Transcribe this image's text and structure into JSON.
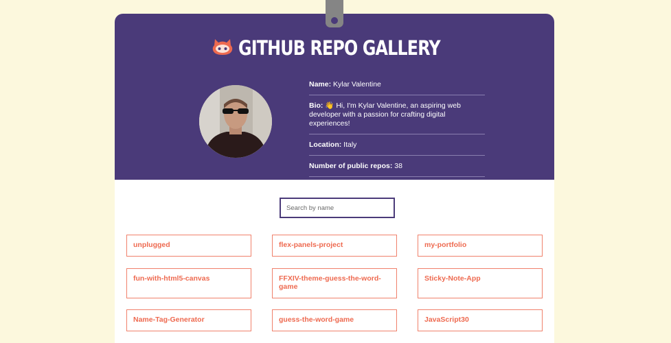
{
  "header": {
    "title": "GITHUB REPO GALLERY",
    "logo_icon": "octocat-icon",
    "background_color": "#4a3a79"
  },
  "profile": {
    "avatar_icon": "user-avatar",
    "name_label": "Name:",
    "name": "Kylar Valentine",
    "bio_label": "Bio:",
    "bio_emoji": "👋",
    "bio": "Hi, I'm Kylar Valentine, an aspiring web developer with a passion for crafting digital experiences!",
    "location_label": "Location:",
    "location": "Italy",
    "repos_label": "Number of public repos:",
    "repos_count": "38"
  },
  "search": {
    "placeholder": "Search by name",
    "value": ""
  },
  "repos": [
    {
      "name": "unplugged"
    },
    {
      "name": "flex-panels-project"
    },
    {
      "name": "my-portfolio"
    },
    {
      "name": "fun-with-html5-canvas"
    },
    {
      "name": "FFXIV-theme-guess-the-word-game"
    },
    {
      "name": "Sticky-Note-App"
    },
    {
      "name": "Name-Tag-Generator"
    },
    {
      "name": "guess-the-word-game"
    },
    {
      "name": "JavaScript30"
    }
  ],
  "colors": {
    "page_background": "#fcf8dd",
    "accent": "#ee6a50",
    "header": "#4a3a79"
  }
}
